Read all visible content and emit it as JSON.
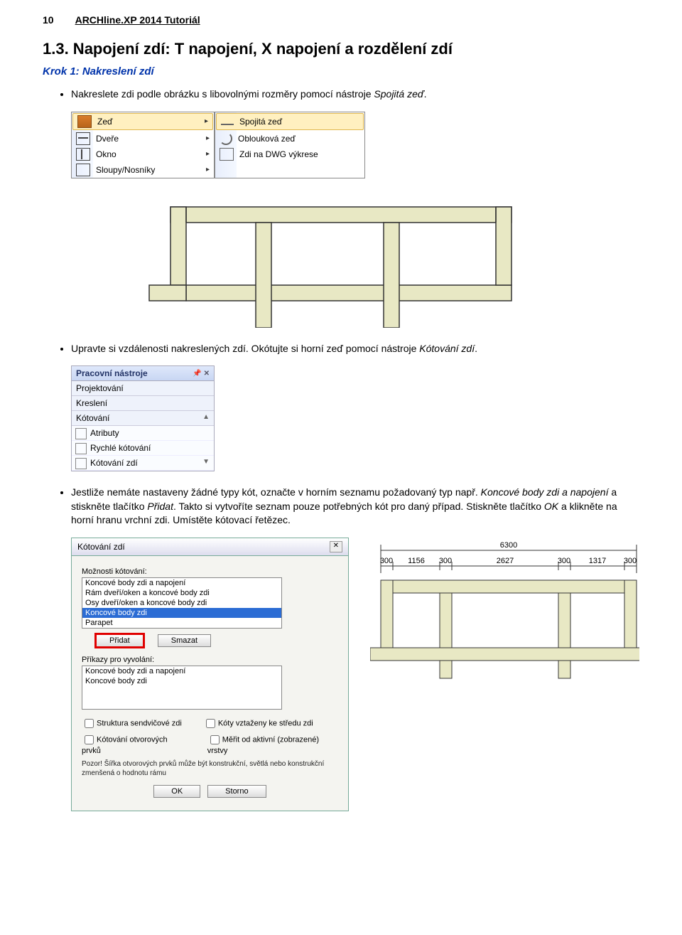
{
  "header": {
    "pagenum": "10",
    "title": "ARCHline.XP 2014 Tutoriál"
  },
  "section": "1.3. Napojení zdí: T napojení, X napojení a rozdělení zdí",
  "step1": "Krok 1: Nakreslení zdí",
  "bullet1_a": "Nakreslete zdi podle obrázku s libovolnými rozměry pomocí nástroje ",
  "bullet1_b": "Spojitá zeď",
  "bullet1_c": ".",
  "menu": {
    "left": [
      "Zeď",
      "Dveře",
      "Okno",
      "Sloupy/Nosníky"
    ],
    "right": [
      "Spojitá zeď",
      "Oblouková zeď",
      "Zdi na DWG výkrese"
    ]
  },
  "bullet2_a": "Upravte si vzdálenosti nakreslených zdí. Okótujte si horní zeď pomocí nástroje ",
  "bullet2_b": "Kótování zdí",
  "bullet2_c": ".",
  "toolpanel": {
    "hdr": "Pracovní nástroje",
    "subs": [
      "Projektování",
      "Kreslení",
      "Kótování"
    ],
    "items": [
      "Atributy",
      "Rychlé kótování",
      "Kótování zdí"
    ]
  },
  "bullet3_a": "Jestliže nemáte nastaveny žádné typy kót, označte v horním seznamu požadovaný typ např. ",
  "bullet3_b": "Koncové body zdi a napojení",
  "bullet3_c": " a stiskněte tlačítko ",
  "bullet3_d": "Přidat",
  "bullet3_e": ". Takto si vytvoříte seznam pouze potřebných kót pro daný případ. Stiskněte tlačítko ",
  "bullet3_f": "OK",
  "bullet3_g": " a klikněte na horní hranu vrchní zdi. Umístěte kótovací řetězec.",
  "dialog": {
    "title": "Kótování zdí",
    "lbl1": "Možnosti kótování:",
    "list1": [
      "Koncové body zdi a napojení",
      "Rám dveří/oken a koncové body zdi",
      "Osy dveří/oken a koncové body zdi",
      "Koncové body zdi",
      "Parapet"
    ],
    "list1_sel": 3,
    "btn_add": "Přidat",
    "btn_del": "Smazat",
    "lbl2": "Příkazy pro vyvolání:",
    "list2": [
      "Koncové body zdi a napojení",
      "Koncové body zdi"
    ],
    "chk1": "Struktura sendvičové zdi",
    "chk2": "Kóty vztaženy ke středu zdi",
    "chk3": "Kótování otvorových prvků",
    "chk4": "Měřit od aktivní (zobrazené) vrstvy",
    "note": "Pozor! Šířka otvorových prvků může být konstrukční, světlá nebo konstrukční zmenšená o hodnotu rámu",
    "ok": "OK",
    "cancel": "Storno"
  },
  "chart_data": {
    "type": "bar",
    "title": "",
    "total_label": "6300",
    "segments": [
      300,
      1156,
      300,
      2627,
      300,
      1317,
      300
    ]
  }
}
